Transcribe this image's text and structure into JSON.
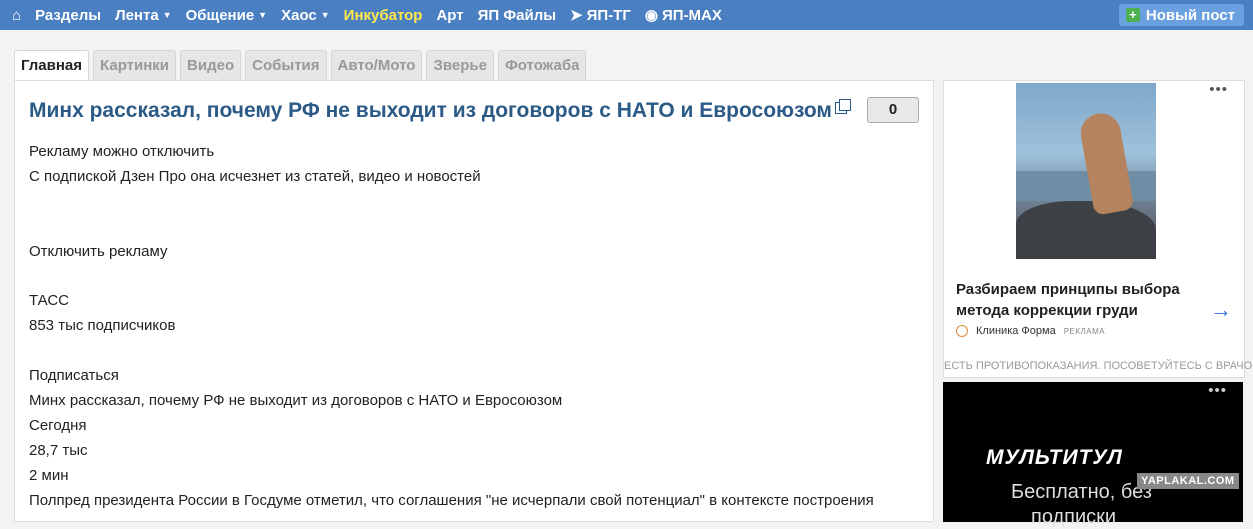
{
  "nav": {
    "items": [
      "Разделы",
      "Лента",
      "Общение",
      "Хаос",
      "Инкубатор",
      "Арт",
      "ЯП Файлы",
      "ЯП-ТГ",
      "ЯП-MAX"
    ],
    "new_post": "Новый пост"
  },
  "tabs": [
    "Главная",
    "Картинки",
    "Видео",
    "События",
    "Авто/Мото",
    "Зверье",
    "Фотожаба"
  ],
  "post": {
    "title": "Минх рассказал, почему РФ не выходит из договоров с НАТО и Евросоюзом",
    "counter": "0",
    "lines": [
      "Рекламу можно отключить",
      "С подпиской Дзен Про она исчезнет из статей, видео и новостей",
      "Отключить рекламу",
      "ТАСС",
      "853 тыс подписчиков",
      "Подписаться",
      "Минх рассказал, почему РФ не выходит из договоров с НАТО и Евросоюзом",
      "Сегодня",
      "28,7 тыс",
      "2 мин",
      "Полпред президента России в Госдуме отметил, что соглашения \"не исчерпали свой потенциал\" в контексте построения"
    ]
  },
  "ad1": {
    "title": "Разбираем принципы выбора метода коррекции груди",
    "source": "Клиника Форма",
    "tag": "РЕКЛАМА",
    "warning": "ЕСТЬ ПРОТИВОПОКАЗАНИЯ. ПОСОВЕТУЙТЕСЬ С ВРАЧОМ"
  },
  "ad2": {
    "logo": "МУЛЬТИТУЛ",
    "line1": "Бесплатно, без",
    "line2": "подписки"
  },
  "watermark": "YAPLAKAL.COM"
}
